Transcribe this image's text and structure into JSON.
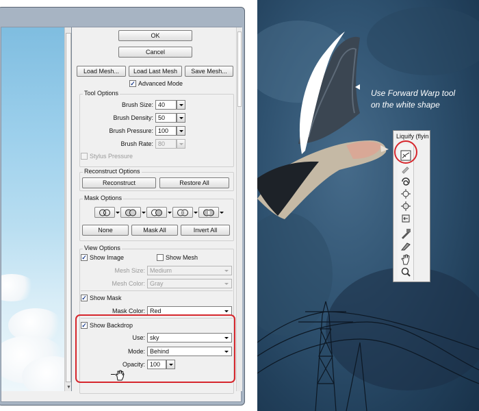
{
  "dialog": {
    "ok_label": "OK",
    "cancel_label": "Cancel",
    "load_mesh_label": "Load Mesh...",
    "load_last_mesh_label": "Load Last Mesh",
    "save_mesh_label": "Save Mesh...",
    "advanced_mode": {
      "label": "Advanced Mode",
      "checked": true
    }
  },
  "tool_options": {
    "title": "Tool Options",
    "brush_size": {
      "label": "Brush Size:",
      "value": "40"
    },
    "brush_density": {
      "label": "Brush Density:",
      "value": "50"
    },
    "brush_pressure": {
      "label": "Brush Pressure:",
      "value": "100"
    },
    "brush_rate": {
      "label": "Brush Rate:",
      "value": "80"
    },
    "stylus_pressure": {
      "label": "Stylus Pressure",
      "checked": false
    }
  },
  "reconstruct_options": {
    "title": "Reconstruct Options",
    "reconstruct_label": "Reconstruct",
    "restore_all_label": "Restore All"
  },
  "mask_options": {
    "title": "Mask Options",
    "none_label": "None",
    "mask_all_label": "Mask All",
    "invert_all_label": "Invert All"
  },
  "view_options": {
    "title": "View Options",
    "show_image": {
      "label": "Show Image",
      "checked": true
    },
    "show_mesh": {
      "label": "Show Mesh",
      "checked": false
    },
    "mesh_size": {
      "label": "Mesh Size:",
      "value": "Medium"
    },
    "mesh_color": {
      "label": "Mesh Color:",
      "value": "Gray"
    },
    "show_mask": {
      "label": "Show Mask",
      "checked": true
    },
    "mask_color": {
      "label": "Mask Color:",
      "value": "Red"
    },
    "show_backdrop": {
      "label": "Show Backdrop",
      "checked": true
    },
    "use": {
      "label": "Use:",
      "value": "sky"
    },
    "mode": {
      "label": "Mode:",
      "value": "Behind"
    },
    "opacity": {
      "label": "Opacity:",
      "value": "100"
    }
  },
  "canvas": {
    "callout_line1": "Use Forward Warp tool",
    "callout_line2": "on the white shape",
    "tool_panel_title": "Liquify (flyin"
  },
  "colors": {
    "highlight_red": "#d6262c",
    "dialog_bg": "#f0f0f0",
    "canvas_sky": "#2f5270"
  },
  "icons": {
    "tools": [
      "forward-warp-icon",
      "reconstruct-tool-icon",
      "twirl-clockwise-icon",
      "pucker-icon",
      "bloat-icon",
      "push-left-icon",
      "freeze-mask-icon",
      "thaw-mask-icon",
      "hand-icon",
      "zoom-icon"
    ]
  }
}
